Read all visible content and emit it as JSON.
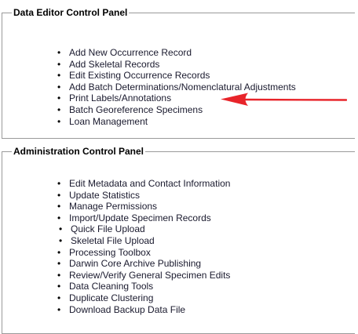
{
  "data_editor_panel": {
    "title": "Data Editor Control Panel",
    "items": [
      {
        "label": "Add New Occurrence Record"
      },
      {
        "label": "Add Skeletal Records"
      },
      {
        "label": "Edit Existing Occurrence Records"
      },
      {
        "label": "Add Batch Determinations/Nomenclatural Adjustments"
      },
      {
        "label": "Print Labels/Annotations"
      },
      {
        "label": "Batch Georeference Specimens"
      },
      {
        "label": "Loan Management"
      }
    ]
  },
  "administration_panel": {
    "title": "Administration Control Panel",
    "items": [
      {
        "label": "Edit Metadata and Contact Information"
      },
      {
        "label": "Update Statistics"
      },
      {
        "label": "Manage Permissions"
      },
      {
        "label": "Import/Update Specimen Records"
      },
      {
        "label": "Quick File Upload"
      },
      {
        "label": "Skeletal File Upload"
      },
      {
        "label": "Processing Toolbox"
      },
      {
        "label": "Darwin Core Archive Publishing"
      },
      {
        "label": "Review/Verify General Specimen Edits"
      },
      {
        "label": "Data Cleaning Tools"
      },
      {
        "label": "Duplicate Clustering"
      },
      {
        "label": "Download Backup Data File"
      }
    ]
  },
  "annotation": {
    "icon": "arrow-left-icon",
    "color": "#e8242a"
  },
  "bullet_glyph": "•"
}
